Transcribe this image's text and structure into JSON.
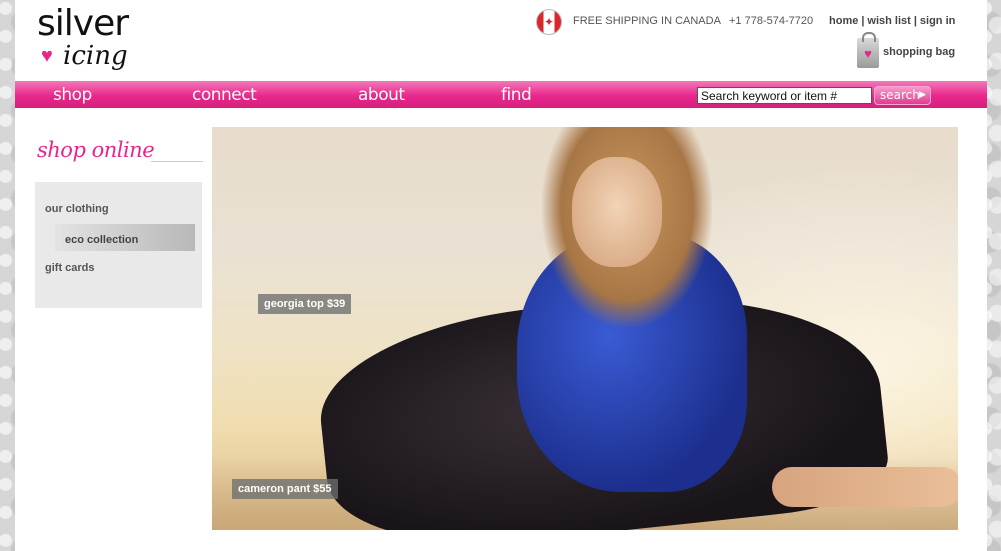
{
  "header": {
    "logo_line1": "silver",
    "logo_line2": "icing",
    "shipping_text": "FREE SHIPPING IN CANADA",
    "phone": "+1 778-574-7720",
    "links": {
      "home": "home",
      "wishlist": "wish list",
      "signin": "sign in",
      "separator": "|"
    },
    "bag_label": "shopping bag"
  },
  "nav": {
    "items": [
      "shop",
      "connect",
      "about",
      "find"
    ],
    "search_placeholder": "Search keyword or item #",
    "search_button": "search"
  },
  "sidebar": {
    "heading": "shop online",
    "items": [
      {
        "label": "our clothing"
      },
      {
        "label": "eco collection"
      },
      {
        "label": "gift cards"
      }
    ]
  },
  "hero": {
    "tags": [
      {
        "label": "georgia top $39"
      },
      {
        "label": "cameron pant $55"
      }
    ]
  },
  "colors": {
    "accent": "#e6268a",
    "nav_top": "#f478b8",
    "nav_bottom": "#d61f7d",
    "sidebar_bg": "#e9e9e9"
  }
}
